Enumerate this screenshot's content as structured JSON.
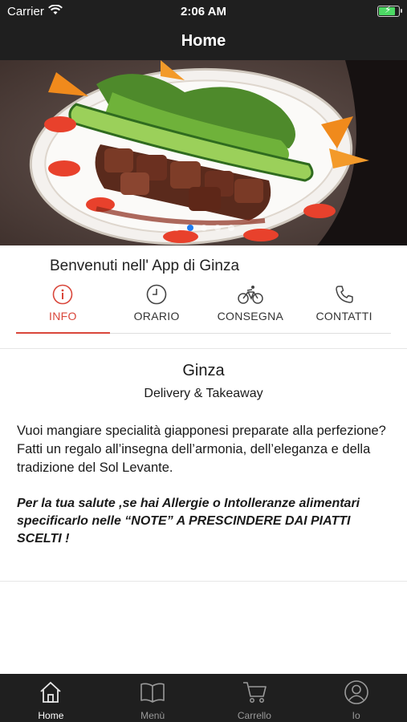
{
  "status_bar": {
    "carrier": "Carrier",
    "time": "2:06 AM"
  },
  "nav": {
    "title": "Home"
  },
  "carousel": {
    "slide_count": 5,
    "active_index": 1
  },
  "welcome": "Benvenuti nell' App di Ginza",
  "tabs": [
    {
      "label": "INFO",
      "icon": "info-icon",
      "active": true
    },
    {
      "label": "ORARIO",
      "icon": "clock-icon",
      "active": false
    },
    {
      "label": "CONSEGNA",
      "icon": "bicycle-icon",
      "active": false
    },
    {
      "label": "CONTATTI",
      "icon": "phone-icon",
      "active": false
    }
  ],
  "info": {
    "name": "Ginza",
    "subtitle": "Delivery & Takeaway",
    "description": "Vuoi mangiare specialità giapponesi preparate alla perfezione? Fatti un regalo all’insegna dell’armonia, dell’eleganza e della tradizione del Sol Levante.",
    "note": "Per la tua salute ,se hai Allergie o Intolleranze alimentari specificarlo nelle “NOTE” A PRESCINDERE DAI PIATTI SCELTI !"
  },
  "tabbar": [
    {
      "label": "Home",
      "icon": "home-icon",
      "active": true
    },
    {
      "label": "Menù",
      "icon": "book-icon",
      "active": false
    },
    {
      "label": "Carrello",
      "icon": "cart-icon",
      "active": false
    },
    {
      "label": "Io",
      "icon": "user-icon",
      "active": false
    }
  ],
  "colors": {
    "accent": "#d9463a",
    "bar": "#1f1f1f",
    "page_dot_active": "#1e7cf2"
  }
}
